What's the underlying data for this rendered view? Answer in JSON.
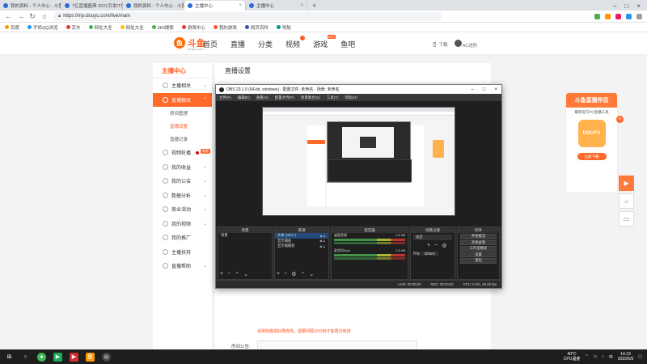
{
  "browser": {
    "tabs": [
      {
        "label": "我的资料 - 个人中心 - 斗鱼",
        "active": false
      },
      {
        "label": "7亿直播盛典 2021引发IT热",
        "active": false
      },
      {
        "label": "我的资料 - 个人中心 - 斗鱼",
        "active": false
      },
      {
        "label": "主播中心",
        "active": true
      },
      {
        "label": "主播中心",
        "active": false
      }
    ],
    "url": "https://mp.douyu.com/live/main",
    "bookmarks": [
      "百度",
      "手机QQ浏览",
      "京东",
      "网址大全",
      "网址大全",
      "360搜索",
      "游戏中心",
      "我的游戏",
      "网页百科",
      "导航"
    ]
  },
  "header": {
    "logo_text": "斗鱼",
    "logo_sub": "douyu.com",
    "nav": [
      "首页",
      "直播",
      "分类",
      "视频",
      "游戏",
      "鱼吧"
    ],
    "hot_tag": "HOT",
    "download_label": "下载",
    "user_name": "AC进阶"
  },
  "sidebar": {
    "title": "主播中心",
    "items": [
      {
        "label": "主播相关",
        "type": "group"
      },
      {
        "label": "直播相关",
        "type": "group-active"
      },
      {
        "label": "房间管理",
        "type": "sub"
      },
      {
        "label": "直播设置",
        "type": "sub-current"
      },
      {
        "label": "直播记录",
        "type": "sub"
      },
      {
        "label": "视频轮播",
        "type": "group",
        "tag": "新版"
      },
      {
        "label": "我的收益",
        "type": "group"
      },
      {
        "label": "我的公会",
        "type": "group"
      },
      {
        "label": "数据分析",
        "type": "group"
      },
      {
        "label": "商业活动",
        "type": "group"
      },
      {
        "label": "我的视频",
        "type": "group"
      },
      {
        "label": "我的推广",
        "type": "group"
      },
      {
        "label": "主播扶持",
        "type": "group"
      },
      {
        "label": "直播帮助",
        "type": "group"
      }
    ]
  },
  "main": {
    "heading": "直播设置",
    "notice": "请将标题选好再修改，需要间隔10分钟才能再次修改",
    "announcement_label": "房间公告:"
  },
  "obs": {
    "title": "OBS 23.1.0 (64-bit, windows) - 配置文件: 未命名 - 场景: 未命名",
    "menu": [
      "文件(F)",
      "编辑(E)",
      "查看(V)",
      "配置文件(P)",
      "场景集合(S)",
      "工具(T)",
      "帮助(H)"
    ],
    "docks": {
      "scenes": {
        "title": "场景",
        "items": [
          "场景"
        ]
      },
      "sources": {
        "title": "来源",
        "items": [
          "文本 (GDI+)",
          "显示捕获",
          "显示器捕获"
        ]
      },
      "mixer": {
        "title": "混音器",
        "channels": [
          {
            "name": "桌面音频",
            "db": "0.0 dB"
          },
          {
            "name": "麦克风/Aux",
            "db": "0.0 dB"
          }
        ]
      },
      "transitions": {
        "title": "场景过渡",
        "type": "淡出",
        "duration_label": "时长",
        "duration": "300ms"
      },
      "controls": {
        "title": "控件",
        "buttons": [
          "开始推流",
          "开始录制",
          "工作室模式",
          "设置",
          "退出"
        ]
      }
    },
    "status": [
      "LIVE: 00:00:00",
      "REC: 00:00:00",
      "CPU: 0.3%, 60.00 fps"
    ]
  },
  "ad": {
    "title": "斗鱼直播伴侣",
    "subtitle": "最新官方PC直播工具",
    "app_name": "DOUYU",
    "button": "立即下载"
  },
  "taskbar": {
    "temp": "40°C",
    "temp_label": "CPU温度",
    "time": "14:19",
    "date": "2022/5/5"
  }
}
